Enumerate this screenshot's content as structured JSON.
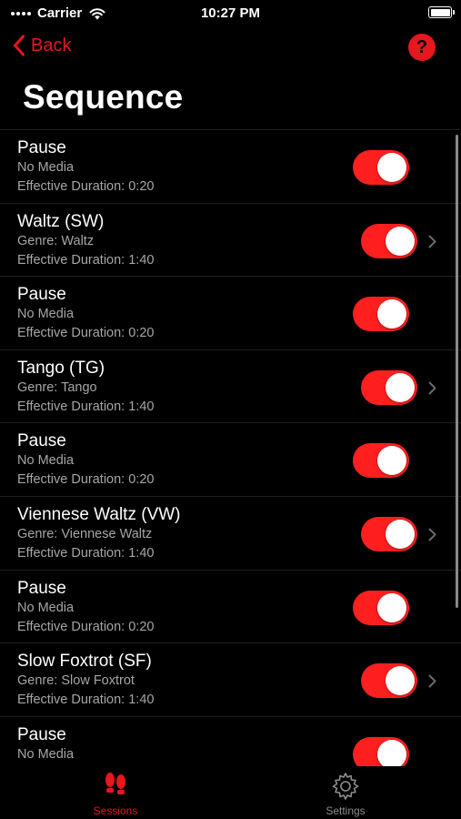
{
  "status_bar": {
    "carrier": "Carrier",
    "time": "10:27 PM"
  },
  "nav": {
    "back_label": "Back",
    "help_label": "?"
  },
  "page": {
    "title": "Sequence"
  },
  "rows": [
    {
      "title": "Pause",
      "subtitle": "No Media",
      "duration": "Effective Duration: 0:20",
      "enabled": true,
      "has_detail": false
    },
    {
      "title": "Waltz (SW)",
      "subtitle": "Genre: Waltz",
      "duration": "Effective Duration: 1:40",
      "enabled": true,
      "has_detail": true
    },
    {
      "title": "Pause",
      "subtitle": "No Media",
      "duration": "Effective Duration: 0:20",
      "enabled": true,
      "has_detail": false
    },
    {
      "title": "Tango (TG)",
      "subtitle": "Genre: Tango",
      "duration": "Effective Duration: 1:40",
      "enabled": true,
      "has_detail": true
    },
    {
      "title": "Pause",
      "subtitle": "No Media",
      "duration": "Effective Duration: 0:20",
      "enabled": true,
      "has_detail": false
    },
    {
      "title": "Viennese Waltz (VW)",
      "subtitle": "Genre: Viennese Waltz",
      "duration": "Effective Duration: 1:40",
      "enabled": true,
      "has_detail": true
    },
    {
      "title": "Pause",
      "subtitle": "No Media",
      "duration": "Effective Duration: 0:20",
      "enabled": true,
      "has_detail": false
    },
    {
      "title": "Slow Foxtrot (SF)",
      "subtitle": "Genre: Slow Foxtrot",
      "duration": "Effective Duration: 1:40",
      "enabled": true,
      "has_detail": true
    },
    {
      "title": "Pause",
      "subtitle": "No Media",
      "duration": "",
      "enabled": true,
      "has_detail": false
    }
  ],
  "tab_bar": {
    "tabs": [
      {
        "label": "Sessions",
        "icon": "footprints-icon",
        "active": true
      },
      {
        "label": "Settings",
        "icon": "gear-icon",
        "active": false
      }
    ]
  },
  "colors": {
    "accent": "#e8161d",
    "toggle_on": "#ff1f1f",
    "secondary_text": "#a6a6a6",
    "background": "#000000"
  }
}
